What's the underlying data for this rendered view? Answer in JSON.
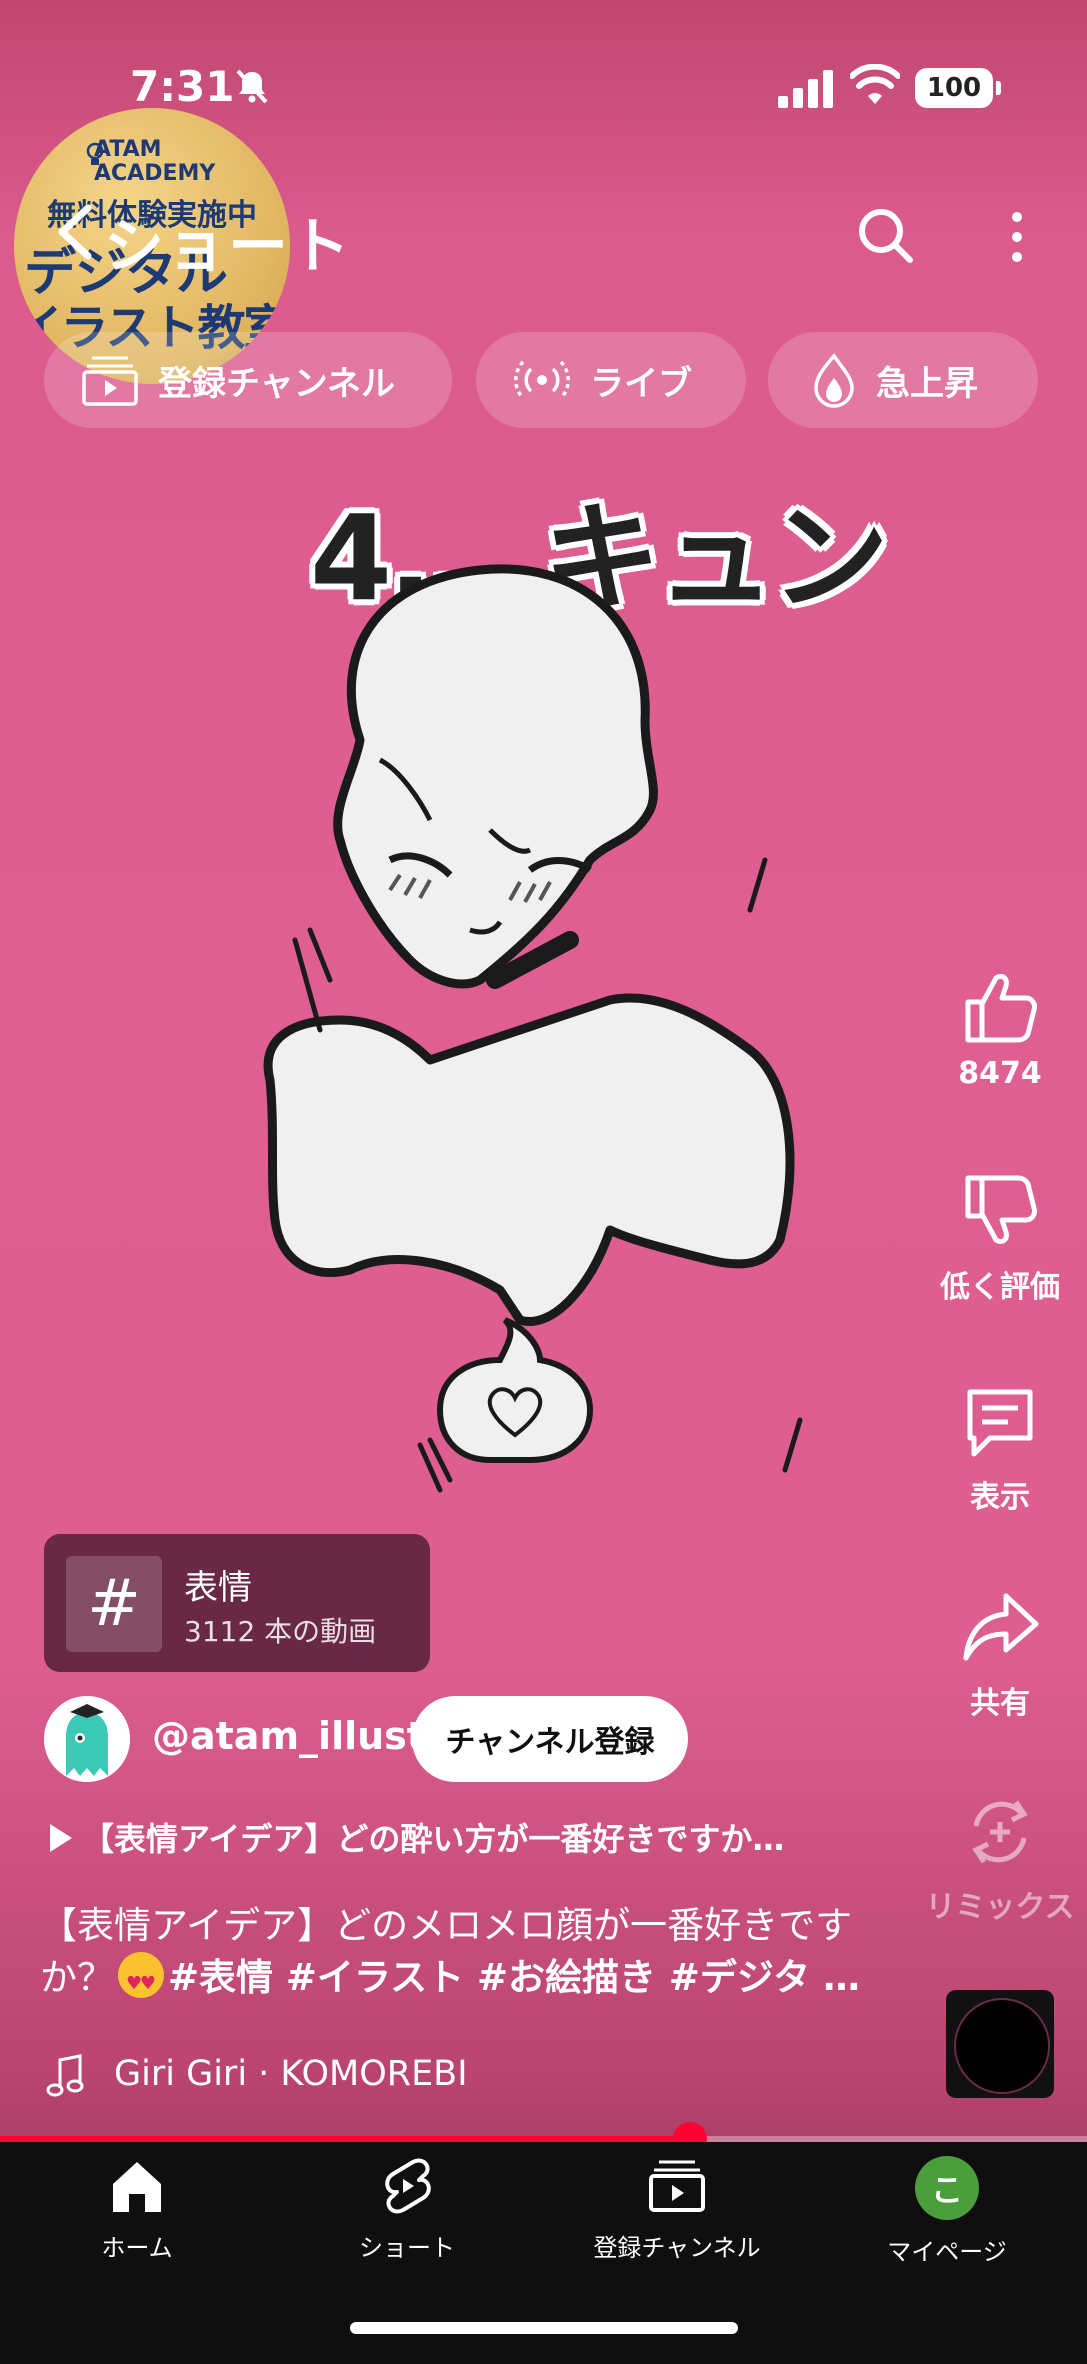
{
  "status": {
    "time": "7:31",
    "battery": "100"
  },
  "ad": {
    "brand_line1": "ATAM",
    "brand_line2": "ACADEMY",
    "line1": "無料体験実施中",
    "line2": "デジタル",
    "line3": "イラスト教室"
  },
  "header": {
    "title": "ショート"
  },
  "chips": [
    {
      "label": "登録チャンネル",
      "icon": "subscriptions-icon"
    },
    {
      "label": "ライブ",
      "icon": "live-icon"
    },
    {
      "label": "急上昇",
      "icon": "trending-icon"
    }
  ],
  "video": {
    "overlay_text": "4.…キュン"
  },
  "actions": {
    "like_count": "8474",
    "dislike_label": "低く評価",
    "comment_label": "表示",
    "share_label": "共有",
    "remix_label": "リミックス"
  },
  "hashtag": {
    "symbol": "#",
    "name": "表情",
    "count": "3112 本の動画"
  },
  "channel": {
    "handle": "@atam_illust",
    "subscribe_label": "チャンネル登録"
  },
  "related": {
    "text": "【表情アイデア】どの酔い方が一番好きですか…"
  },
  "caption": {
    "text_line1": "【表情アイデア】どのメロメロ顔が一番好きです",
    "text_line2_prefix": "か？",
    "tags": "#表情 #イラスト #お絵描き #デジタ …"
  },
  "music": {
    "label": "Giri Giri · KOMOREBI"
  },
  "progress": {
    "fraction": 0.635
  },
  "colors": {
    "accent": "#ff0033",
    "background": "#df5f92",
    "nav_bg": "#0f0f0f"
  },
  "nav": [
    {
      "label": "ホーム",
      "icon": "home-icon"
    },
    {
      "label": "ショート",
      "icon": "shorts-icon"
    },
    {
      "label": "登録チャンネル",
      "icon": "subscriptions-icon"
    },
    {
      "label": "マイページ",
      "avatar_letter": "こ"
    }
  ]
}
